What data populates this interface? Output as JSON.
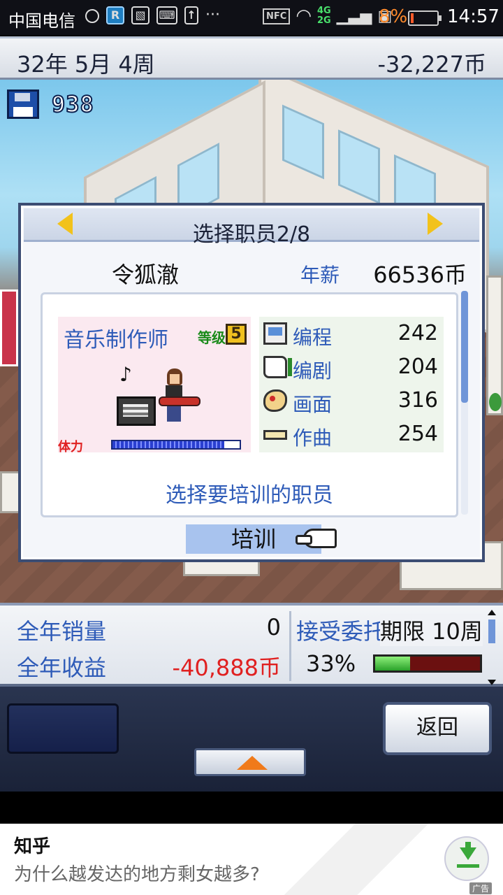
{
  "status_bar": {
    "carrier": "中国电信",
    "icon_r": "R",
    "nfc": "NFC",
    "network_4g": "4G",
    "network_2g": "2G",
    "battery": "8%",
    "time": "14:57"
  },
  "top_bar": {
    "date": "32年 5月 4周",
    "money": "-32,227币"
  },
  "save": {
    "count": "938"
  },
  "dialog": {
    "title": "选择职员2/8",
    "staff_name": "令狐澈",
    "salary_label": "年薪",
    "salary_value": "66536币",
    "job": "音乐制作师",
    "level_label": "等级",
    "level": "5",
    "stamina_label": "体力",
    "stamina_fraction": 0.88,
    "stats": [
      {
        "icon": "computer-icon",
        "label": "编程",
        "value": "242"
      },
      {
        "icon": "book-icon",
        "label": "编剧",
        "value": "204"
      },
      {
        "icon": "palette-icon",
        "label": "画面",
        "value": "316"
      },
      {
        "icon": "flute-icon",
        "label": "作曲",
        "value": "254"
      }
    ],
    "prompt": "选择要培训的职员",
    "train_button": "培训"
  },
  "bottom_info": {
    "sales_label": "全年销量",
    "sales_value": "0",
    "revenue_label": "全年收益",
    "revenue_value": "-40,888币",
    "commission_label": "接受委托",
    "deadline": "期限 10周",
    "progress_pct": "33%",
    "progress_fraction": 0.33
  },
  "controls": {
    "back_button": "返回"
  },
  "ad": {
    "title": "知乎",
    "text": "为什么越发达的地方剩女越多?",
    "tag": "广告"
  },
  "colors": {
    "accent_blue": "#2e5bb8",
    "negative_red": "#e02020",
    "progress_green": "#2aa12a",
    "arrow_yellow": "#f2c21b",
    "up_arrow_orange": "#f07a1a"
  }
}
